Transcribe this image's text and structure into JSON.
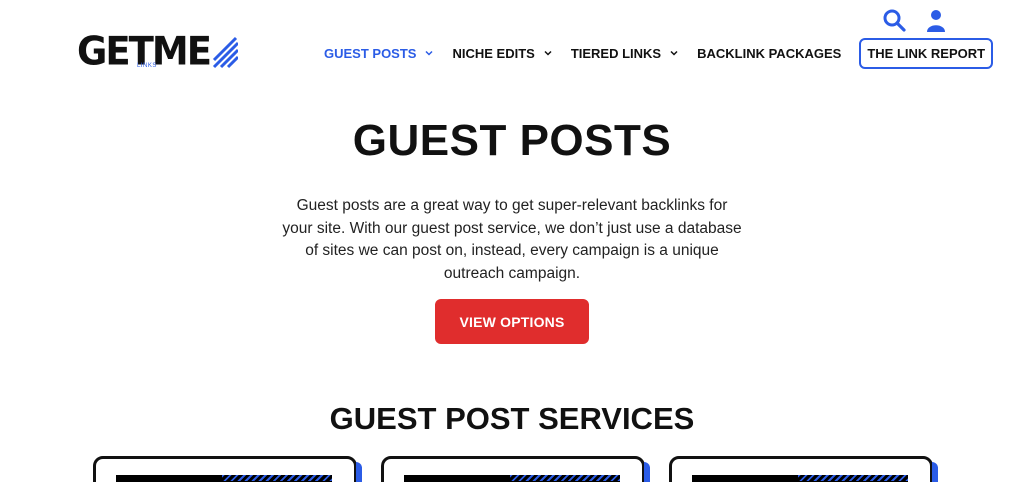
{
  "header": {
    "logo": {
      "wordmark": "GETME",
      "sub": "LINKS"
    },
    "icons": [
      "search-icon",
      "user-icon"
    ],
    "nav": [
      {
        "label": "GUEST POSTS",
        "active": true,
        "dropdown": true
      },
      {
        "label": "NICHE EDITS",
        "active": false,
        "dropdown": true
      },
      {
        "label": "TIERED LINKS",
        "active": false,
        "dropdown": true
      },
      {
        "label": "BACKLINK PACKAGES",
        "active": false,
        "dropdown": false
      },
      {
        "label": "THE LINK REPORT",
        "active": false,
        "dropdown": false,
        "boxed": true
      }
    ]
  },
  "hero": {
    "title": "GUEST POSTS",
    "description": "Guest posts are a great way to get super-relevant backlinks for your site. With our guest post service, we don’t just use a database of sites we can post on, instead, every campaign is a unique outreach campaign.",
    "cta_label": "VIEW OPTIONS"
  },
  "services": {
    "title": "GUEST POST SERVICES",
    "cards": [
      {},
      {},
      {}
    ]
  },
  "colors": {
    "accent_blue": "#2b5ce6",
    "cta_red": "#e02d2d",
    "text_dark": "#111111"
  }
}
